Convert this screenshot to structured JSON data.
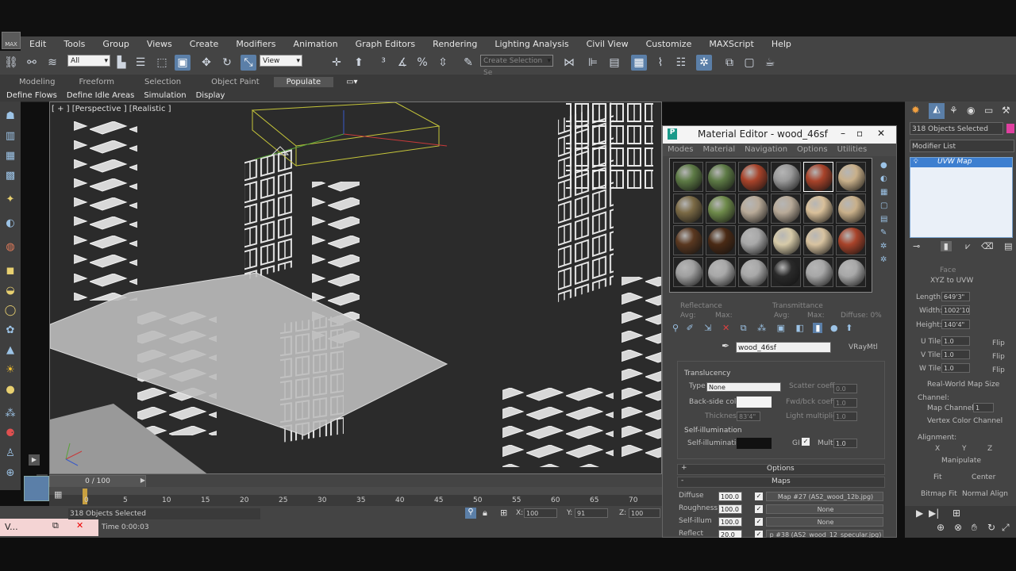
{
  "menu": [
    "Edit",
    "Tools",
    "Group",
    "Views",
    "Create",
    "Modifiers",
    "Animation",
    "Graph Editors",
    "Rendering",
    "Lighting Analysis",
    "Civil View",
    "Customize",
    "MAXScript",
    "Help"
  ],
  "toolbar": {
    "filter_value": "All",
    "ref_coord_value": "View",
    "selection_set_placeholder": "Create Selection Se"
  },
  "ribbon": {
    "tabs": [
      "Modeling",
      "Freeform",
      "Selection",
      "Object Paint",
      "Populate"
    ],
    "active_tab": "Populate",
    "sub_items": [
      "Define Flows",
      "Define Idle Areas",
      "Simulation",
      "Display"
    ]
  },
  "viewport": {
    "label": "[ + ] [Perspective ] [Realistic ]"
  },
  "timeline": {
    "slider_label": "0 / 100",
    "ticks": [
      "0",
      "5",
      "10",
      "15",
      "20",
      "25",
      "30",
      "35",
      "40",
      "45",
      "50",
      "55",
      "60",
      "65",
      "70"
    ]
  },
  "status": {
    "selected_text": "318 Objects Selected",
    "time_text": "Time 0:00:03",
    "x_label": "X:",
    "x_value": "100",
    "y_label": "Y:",
    "y_value": "91",
    "z_label": "Z:",
    "z_value": "100",
    "maxscript_label": "V..."
  },
  "material_editor": {
    "title": "Material Editor - wood_46sf",
    "menus": [
      "Modes",
      "Material",
      "Navigation",
      "Options",
      "Utilities"
    ],
    "slot_colors": [
      "#5d7a45",
      "#5d7a45",
      "#a8432a",
      "#9a9a9a",
      "#a8432a",
      "#c9b08a",
      "#7b6a45",
      "#6e8a4a",
      "#b8aa98",
      "#b8aa98",
      "#d9c09a",
      "#c9b08a",
      "#5a3820",
      "#4a2a15",
      "#a8a8a8",
      "#d6caa8",
      "#d8c3a0",
      "#a8432a",
      "#a0a0a0",
      "#a8a8a8",
      "#a8a8a8",
      "#2a2a2a",
      "#a8a8a8",
      "#a8a8a8"
    ],
    "reflectance_label": "Reflectance",
    "transmittance_label": "Transmittance",
    "avg_label": "Avg:",
    "max_label": "Max:",
    "diffuse_pct": "Diffuse: 0%",
    "material_name": "wood_46sf",
    "material_type": "VRayMtl",
    "translucency": {
      "header": "Translucency",
      "type_label": "Type",
      "type_value": "None",
      "scatter_label": "Scatter coeff",
      "scatter_value": "0.0",
      "backside_label": "Back-side color",
      "fwdbck_label": "Fwd/bck coeff",
      "fwdbck_value": "1.0",
      "thickness_label": "Thickness",
      "thickness_value": "83'4\"",
      "light_mult_label": "Light multiplier",
      "light_mult_value": "1.0"
    },
    "self_illum": {
      "header": "Self-illumination",
      "label": "Self-illumination",
      "gi_label": "GI",
      "mult_label": "Mult",
      "mult_value": "1.0"
    },
    "options_label": "Options",
    "maps_label": "Maps",
    "maps": [
      {
        "name": "Diffuse",
        "value": "100.0",
        "map": "Map #27 (AS2_wood_12b.jpg)"
      },
      {
        "name": "Roughness",
        "value": "100.0",
        "map": "None"
      },
      {
        "name": "Self-illum",
        "value": "100.0",
        "map": "None"
      },
      {
        "name": "Reflect",
        "value": "20.0",
        "map": "p #38 (AS2_wood_12_specular.jpg)"
      }
    ]
  },
  "command_panel": {
    "selection_text": "318 Objects Selected",
    "modifier_list_label": "Modifier List",
    "stack_item": "UVW Map",
    "face_label": "Face",
    "xyz_to_uvw": "XYZ to UVW",
    "length_label": "Length:",
    "length_value": "649'3\"",
    "width_label": "Width:",
    "width_value": "1002'10\"",
    "height_label": "Height:",
    "height_value": "140'4\"",
    "utile_label": "U Tile:",
    "utile_value": "1.0",
    "vtile_label": "V Tile:",
    "vtile_value": "1.0",
    "wtile_label": "W Tile:",
    "wtile_value": "1.0",
    "flip_label": "Flip",
    "real_world_label": "Real-World Map Size",
    "channel_header": "Channel:",
    "map_channel_label": "Map Channel:",
    "map_channel_value": "1",
    "vertex_channel_label": "Vertex Color Channel",
    "alignment_header": "Alignment:",
    "axis_x": "X",
    "axis_y": "Y",
    "axis_z": "Z",
    "manipulate_label": "Manipulate",
    "fit_label": "Fit",
    "center_label": "Center",
    "bitmap_fit_label": "Bitmap Fit",
    "normal_align_label": "Normal Align"
  },
  "colors": {
    "accent": "#5b7fa8",
    "ui_bg": "#444444",
    "viewport_bg": "#2b2b2b"
  }
}
